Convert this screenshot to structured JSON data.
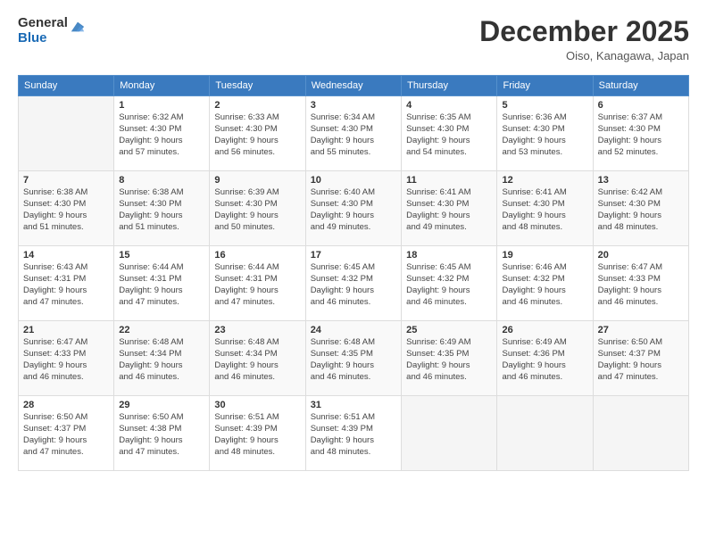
{
  "logo": {
    "general": "General",
    "blue": "Blue"
  },
  "header": {
    "month": "December 2025",
    "location": "Oiso, Kanagawa, Japan"
  },
  "weekdays": [
    "Sunday",
    "Monday",
    "Tuesday",
    "Wednesday",
    "Thursday",
    "Friday",
    "Saturday"
  ],
  "weeks": [
    [
      {
        "day": "",
        "info": ""
      },
      {
        "day": "1",
        "info": "Sunrise: 6:32 AM\nSunset: 4:30 PM\nDaylight: 9 hours\nand 57 minutes."
      },
      {
        "day": "2",
        "info": "Sunrise: 6:33 AM\nSunset: 4:30 PM\nDaylight: 9 hours\nand 56 minutes."
      },
      {
        "day": "3",
        "info": "Sunrise: 6:34 AM\nSunset: 4:30 PM\nDaylight: 9 hours\nand 55 minutes."
      },
      {
        "day": "4",
        "info": "Sunrise: 6:35 AM\nSunset: 4:30 PM\nDaylight: 9 hours\nand 54 minutes."
      },
      {
        "day": "5",
        "info": "Sunrise: 6:36 AM\nSunset: 4:30 PM\nDaylight: 9 hours\nand 53 minutes."
      },
      {
        "day": "6",
        "info": "Sunrise: 6:37 AM\nSunset: 4:30 PM\nDaylight: 9 hours\nand 52 minutes."
      }
    ],
    [
      {
        "day": "7",
        "info": "Sunrise: 6:38 AM\nSunset: 4:30 PM\nDaylight: 9 hours\nand 51 minutes."
      },
      {
        "day": "8",
        "info": "Sunrise: 6:38 AM\nSunset: 4:30 PM\nDaylight: 9 hours\nand 51 minutes."
      },
      {
        "day": "9",
        "info": "Sunrise: 6:39 AM\nSunset: 4:30 PM\nDaylight: 9 hours\nand 50 minutes."
      },
      {
        "day": "10",
        "info": "Sunrise: 6:40 AM\nSunset: 4:30 PM\nDaylight: 9 hours\nand 49 minutes."
      },
      {
        "day": "11",
        "info": "Sunrise: 6:41 AM\nSunset: 4:30 PM\nDaylight: 9 hours\nand 49 minutes."
      },
      {
        "day": "12",
        "info": "Sunrise: 6:41 AM\nSunset: 4:30 PM\nDaylight: 9 hours\nand 48 minutes."
      },
      {
        "day": "13",
        "info": "Sunrise: 6:42 AM\nSunset: 4:30 PM\nDaylight: 9 hours\nand 48 minutes."
      }
    ],
    [
      {
        "day": "14",
        "info": "Sunrise: 6:43 AM\nSunset: 4:31 PM\nDaylight: 9 hours\nand 47 minutes."
      },
      {
        "day": "15",
        "info": "Sunrise: 6:44 AM\nSunset: 4:31 PM\nDaylight: 9 hours\nand 47 minutes."
      },
      {
        "day": "16",
        "info": "Sunrise: 6:44 AM\nSunset: 4:31 PM\nDaylight: 9 hours\nand 47 minutes."
      },
      {
        "day": "17",
        "info": "Sunrise: 6:45 AM\nSunset: 4:32 PM\nDaylight: 9 hours\nand 46 minutes."
      },
      {
        "day": "18",
        "info": "Sunrise: 6:45 AM\nSunset: 4:32 PM\nDaylight: 9 hours\nand 46 minutes."
      },
      {
        "day": "19",
        "info": "Sunrise: 6:46 AM\nSunset: 4:32 PM\nDaylight: 9 hours\nand 46 minutes."
      },
      {
        "day": "20",
        "info": "Sunrise: 6:47 AM\nSunset: 4:33 PM\nDaylight: 9 hours\nand 46 minutes."
      }
    ],
    [
      {
        "day": "21",
        "info": "Sunrise: 6:47 AM\nSunset: 4:33 PM\nDaylight: 9 hours\nand 46 minutes."
      },
      {
        "day": "22",
        "info": "Sunrise: 6:48 AM\nSunset: 4:34 PM\nDaylight: 9 hours\nand 46 minutes."
      },
      {
        "day": "23",
        "info": "Sunrise: 6:48 AM\nSunset: 4:34 PM\nDaylight: 9 hours\nand 46 minutes."
      },
      {
        "day": "24",
        "info": "Sunrise: 6:48 AM\nSunset: 4:35 PM\nDaylight: 9 hours\nand 46 minutes."
      },
      {
        "day": "25",
        "info": "Sunrise: 6:49 AM\nSunset: 4:35 PM\nDaylight: 9 hours\nand 46 minutes."
      },
      {
        "day": "26",
        "info": "Sunrise: 6:49 AM\nSunset: 4:36 PM\nDaylight: 9 hours\nand 46 minutes."
      },
      {
        "day": "27",
        "info": "Sunrise: 6:50 AM\nSunset: 4:37 PM\nDaylight: 9 hours\nand 47 minutes."
      }
    ],
    [
      {
        "day": "28",
        "info": "Sunrise: 6:50 AM\nSunset: 4:37 PM\nDaylight: 9 hours\nand 47 minutes."
      },
      {
        "day": "29",
        "info": "Sunrise: 6:50 AM\nSunset: 4:38 PM\nDaylight: 9 hours\nand 47 minutes."
      },
      {
        "day": "30",
        "info": "Sunrise: 6:51 AM\nSunset: 4:39 PM\nDaylight: 9 hours\nand 48 minutes."
      },
      {
        "day": "31",
        "info": "Sunrise: 6:51 AM\nSunset: 4:39 PM\nDaylight: 9 hours\nand 48 minutes."
      },
      {
        "day": "",
        "info": ""
      },
      {
        "day": "",
        "info": ""
      },
      {
        "day": "",
        "info": ""
      }
    ]
  ]
}
